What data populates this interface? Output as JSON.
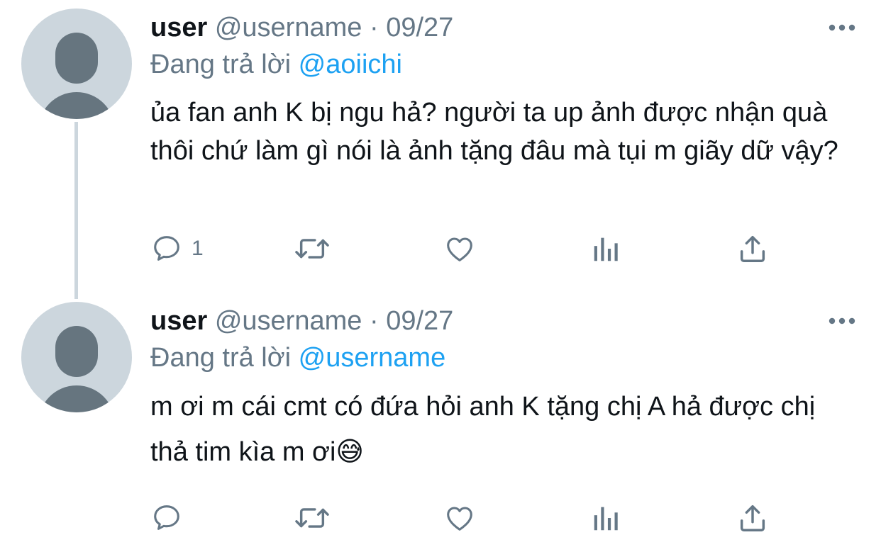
{
  "tweets": [
    {
      "display_name": "user",
      "handle": "@username",
      "separator": "·",
      "date": "09/27",
      "reply_prefix": "Đang trả lời",
      "reply_to": "@aoiichi",
      "text": "ủa fan anh K bị ngu hả? người ta up ảnh được nhận quà thôi chứ làm gì nói là ảnh tặng đâu mà tụi m giãy dữ vậy?",
      "reply_count": "1"
    },
    {
      "display_name": "user",
      "handle": "@username",
      "separator": "·",
      "date": "09/27",
      "reply_prefix": "Đang trả lời",
      "reply_to": "@username",
      "text": "m ơi m cái cmt có đứa hỏi anh K tặng chị A hả được chị thả tim kìa m ơi",
      "emoji": "😅",
      "reply_count": ""
    }
  ],
  "icons": {
    "avatar": "default-avatar",
    "more": "more-dots-icon",
    "reply": "reply-bubble-icon",
    "retweet": "retweet-icon",
    "like": "heart-icon",
    "stats": "analytics-bars-icon",
    "share": "share-upload-icon"
  },
  "colors": {
    "text": "#0f1419",
    "secondary": "#657786",
    "link": "#1da1f2",
    "avatar_bg": "#ccd6dd",
    "avatar_fg": "#66757f"
  }
}
